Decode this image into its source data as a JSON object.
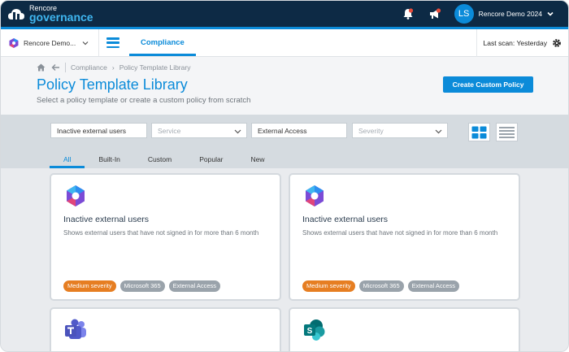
{
  "app": {
    "logo_line1": "Rencore",
    "logo_line2": "governance",
    "user_initials": "LS",
    "user_name": "Rencore Demo 2024",
    "accent": "#0b8bd9",
    "header_bg": "#0d2a45",
    "severity_color": "#e67e22"
  },
  "nav": {
    "tenant": "Rencore Demo...",
    "active_tab": "Compliance",
    "last_scan_label": "Last scan:",
    "last_scan_value": "Yesterday"
  },
  "breadcrumb": {
    "section": "Compliance",
    "separator": "›",
    "page": "Policy Template Library"
  },
  "page": {
    "title": "Policy Template Library",
    "subtitle": "Select a policy template or create a custom policy from scratch",
    "create_button": "Create Custom Policy"
  },
  "filters": {
    "search_value": "Inactive external users",
    "service_placeholder": "Service",
    "keyword_value": "External Access",
    "severity_placeholder": "Severity"
  },
  "tabs": [
    "All",
    "Built-In",
    "Custom",
    "Popular",
    "New"
  ],
  "cards": [
    {
      "icon": "microsoft365-icon",
      "title": "Inactive external users",
      "description": "Shows external users that have not signed in for more than 6 month",
      "tags": [
        "Medium severity",
        "Microsoft 365",
        "External Access"
      ]
    },
    {
      "icon": "microsoft365-icon",
      "title": "Inactive external users",
      "description": "Shows external users that have not signed in for more than 6 month",
      "tags": [
        "Medium severity",
        "Microsoft 365",
        "External Access"
      ]
    },
    {
      "icon": "teams-icon"
    },
    {
      "icon": "sharepoint-icon"
    }
  ]
}
